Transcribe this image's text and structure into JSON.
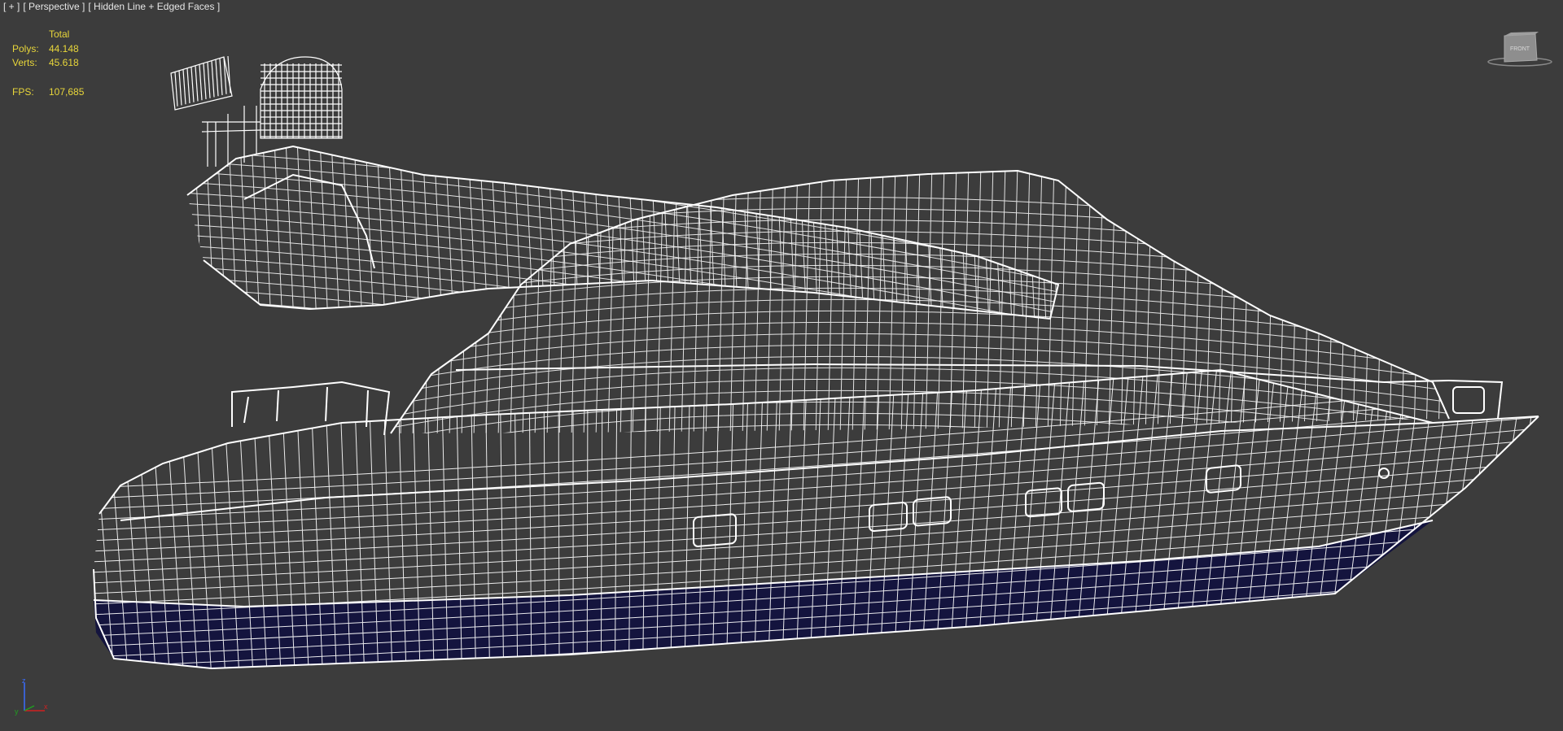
{
  "viewport": {
    "menu_label": "[ + ]",
    "view_label": "[ Perspective ]",
    "shading_label": "[ Hidden Line + Edged Faces ]"
  },
  "stats": {
    "header": "Total",
    "polys_label": "Polys:",
    "polys_value": "44.148",
    "verts_label": "Verts:",
    "verts_value": "45.618",
    "fps_label": "FPS:",
    "fps_value": "107,685"
  },
  "viewcube": {
    "face_label": "FRONT"
  },
  "axis_gizmo": {
    "x": "x",
    "y": "y",
    "z": "z"
  },
  "colors": {
    "background": "#3c3c3c",
    "wire": "#ffffff",
    "hull_bottom": "#14143e",
    "stats_text": "#e8d63a",
    "label_text": "#e6e6e6"
  }
}
